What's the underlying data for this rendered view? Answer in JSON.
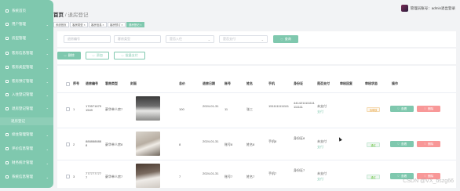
{
  "sidebar": {
    "items": [
      {
        "label": "系统首页",
        "chev": ""
      },
      {
        "label": "用户管理",
        "chev": "⌄"
      },
      {
        "label": "房型管理",
        "chev": "⌄"
      },
      {
        "label": "客房信息管理",
        "chev": "⌄"
      },
      {
        "label": "客房类型管理",
        "chev": "⌄"
      },
      {
        "label": "客房预订管理",
        "chev": "⌄"
      },
      {
        "label": "入住登记管理",
        "chev": "⌄"
      },
      {
        "label": "退房登记管理",
        "chev": "⌃"
      },
      {
        "label": "退房登记",
        "chev": ""
      },
      {
        "label": "续住管理管理",
        "chev": "⌄"
      },
      {
        "label": "评价信息管理",
        "chev": "⌄"
      },
      {
        "label": "财务统计管理",
        "chev": "⌄"
      },
      {
        "label": "系统信息管理",
        "chev": "⌄"
      }
    ]
  },
  "header": {
    "home": "首页",
    "sep": "/",
    "current": "退房登记",
    "user": "管理员账号：admin退出登录"
  },
  "tabs": [
    "系统首页",
    "客房类型 ×",
    "客房信息 ×",
    "客房预订 ×",
    "退房登记 ×"
  ],
  "search": {
    "field1": "退房编号",
    "field2": "客房类型",
    "field3": "是否入住",
    "field4": "是否支付",
    "button": "查询"
  },
  "actions": {
    "delete": "删除",
    "add": "添加",
    "batch": "批量支付"
  },
  "table": {
    "headers": [
      "序号",
      "退房编号",
      "客房类型",
      "封面",
      "总价",
      "退房日期",
      "账号",
      "姓名",
      "手机",
      "身份证",
      "是否支付",
      "审核回复",
      "审核状态",
      "操作"
    ],
    "rows": [
      {
        "index": "1",
        "code": "1705716791549",
        "type": "豪华单人房7",
        "total": "100",
        "date": "2024-01-31",
        "account": "11",
        "name": "张三",
        "phone": "1511111111111",
        "id_card": "4414211111111111111",
        "paid": "未支付",
        "pay_link": "支付",
        "reply": "",
        "status": "待审核",
        "view": "查看",
        "del": "删除"
      },
      {
        "index": "2",
        "code": "8888888888",
        "type": "豪华单人房8",
        "total": "8",
        "date": "2024-01-31",
        "account": "账号8",
        "name": "姓名8",
        "phone": "手机8",
        "id_card": "身份证8",
        "paid": "未支付",
        "pay_link": "支付",
        "reply": "",
        "status": "通过",
        "view": "查看",
        "del": "删除"
      },
      {
        "index": "3",
        "code": "7777777777",
        "type": "豪华单人房7",
        "total": "7",
        "date": "2024-01-31",
        "account": "账号7",
        "name": "姓名7",
        "phone": "手机7",
        "id_card": "身份证7",
        "paid": "未支付",
        "pay_link": "支付",
        "reply": "",
        "status": "通过",
        "view": "查看",
        "del": "删除"
      }
    ]
  },
  "watermark": "CSDN @VX_bszg66",
  "colors": {
    "accent": "#7fc8ae",
    "danger": "#f89898",
    "pending": "#e6a23c"
  }
}
